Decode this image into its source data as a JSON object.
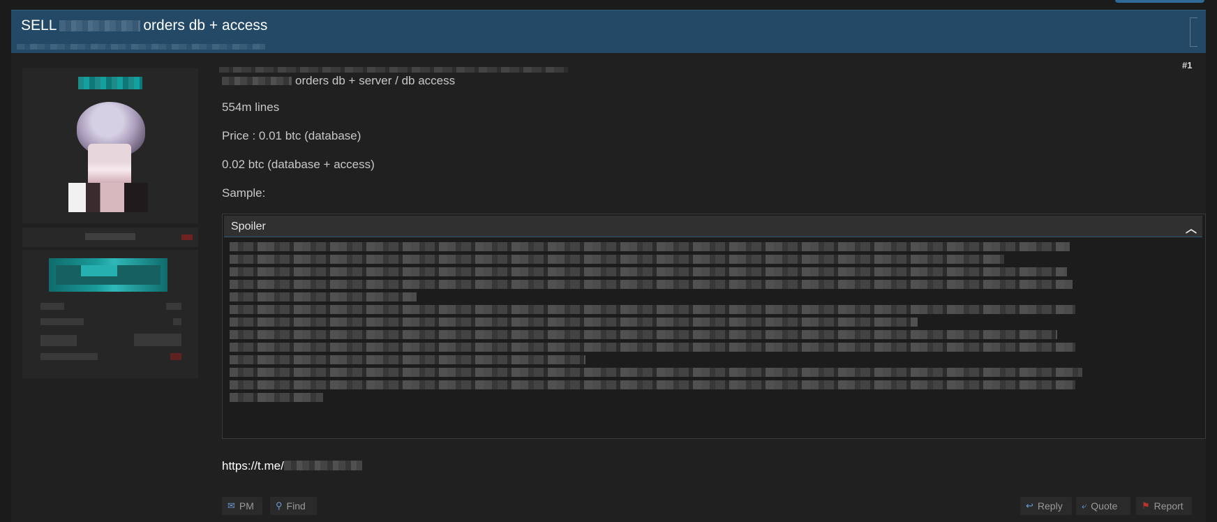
{
  "thread": {
    "title_prefix": "SELL",
    "title_suffix": "orders db + access"
  },
  "post": {
    "number": "#1",
    "line1": "orders db + server / db access",
    "line2": "554m lines",
    "line3": "Price : 0.01 btc (database)",
    "line4": "0.02 btc (database + access)",
    "line5": "Sample:",
    "spoiler_label": "Spoiler",
    "link_prefix": "https://t.me/"
  },
  "actions": {
    "pm": "PM",
    "find": "Find",
    "reply": "Reply",
    "quote": "Quote",
    "report": "Report"
  },
  "icons": {
    "spoiler_toggle": "chevron-up-icon",
    "pm": "envelope-icon",
    "find": "search-icon",
    "reply": "reply-icon",
    "quote": "quote-icon",
    "report": "flag-icon"
  },
  "colors": {
    "header_bg": "#244966",
    "accent_teal": "#1a9a9a",
    "report_flag": "#c0302c"
  }
}
